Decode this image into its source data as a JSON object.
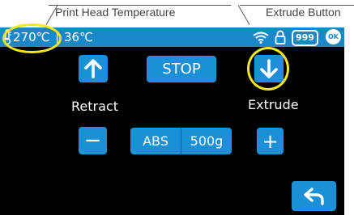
{
  "callouts": {
    "left": "Print Head Temperature",
    "right": "Extrude Button"
  },
  "status_bar": {
    "nozzle_temp": "270℃",
    "separator": "|",
    "bed_temp": "36℃",
    "counter": "999",
    "ok_badge": "OK",
    "icons": [
      "thermometer-icon",
      "wifi-icon",
      "lock-icon"
    ]
  },
  "controls": {
    "stop_label": "STOP",
    "retract_label": "Retract",
    "extrude_label": "Extrude",
    "minus_label": "−",
    "plus_label": "+",
    "material_label": "ABS",
    "length_label": "500g"
  },
  "colors": {
    "accent": "#1b90d6",
    "status_bar": "#1a87c8",
    "highlight": "#f3e81a",
    "screen": "#000000"
  }
}
